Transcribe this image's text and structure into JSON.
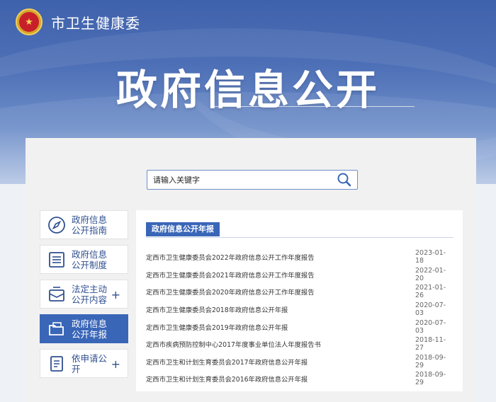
{
  "header": {
    "site_name": "市卫生健康委"
  },
  "banner": {
    "title": "政府信息公开"
  },
  "search": {
    "placeholder": "请输入关键字"
  },
  "menu": {
    "items": [
      {
        "label": "政府信息公开指南",
        "icon": "compass-icon",
        "has_plus": false,
        "active": false
      },
      {
        "label": "政府信息公开制度",
        "icon": "list-icon",
        "has_plus": false,
        "active": false
      },
      {
        "label": "法定主动公开内容",
        "icon": "inbox-icon",
        "has_plus": true,
        "active": false
      },
      {
        "label": "政府信息公开年报",
        "icon": "folder-icon",
        "has_plus": false,
        "active": true
      },
      {
        "label": "依申请公开",
        "icon": "document-icon",
        "has_plus": true,
        "active": false
      }
    ],
    "plus_symbol": "+"
  },
  "content": {
    "tab_label": "政府信息公开年报",
    "rows": [
      {
        "title": "定西市卫生健康委员会2022年政府信息公开工作年度报告",
        "date": "2023-01-18"
      },
      {
        "title": "定西市卫生健康委员会2021年政府信息公开工作年度报告",
        "date": "2022-01-20"
      },
      {
        "title": "定西市卫生健康委员会2020年政府信息公开工作年度报告",
        "date": "2021-01-26"
      },
      {
        "title": "定西市卫生健康委员会2018年政府信息公开年报",
        "date": "2020-07-03"
      },
      {
        "title": "定西市卫生健康委员会2019年政府信息公开年报",
        "date": "2020-07-03"
      },
      {
        "title": "定西市疾病预防控制中心2017年度事业单位法人年度报告书",
        "date": "2018-11-27"
      },
      {
        "title": "定西市卫生和计划生育委员会2017年政府信息公开年报",
        "date": "2018-09-29"
      },
      {
        "title": "定西市卫生和计划生育委员会2016年政府信息公开年报",
        "date": "2018-09-29"
      }
    ]
  },
  "colors": {
    "primary": "#3a66b8",
    "banner": "#4d6fb6",
    "text": "#2f4f8f"
  }
}
